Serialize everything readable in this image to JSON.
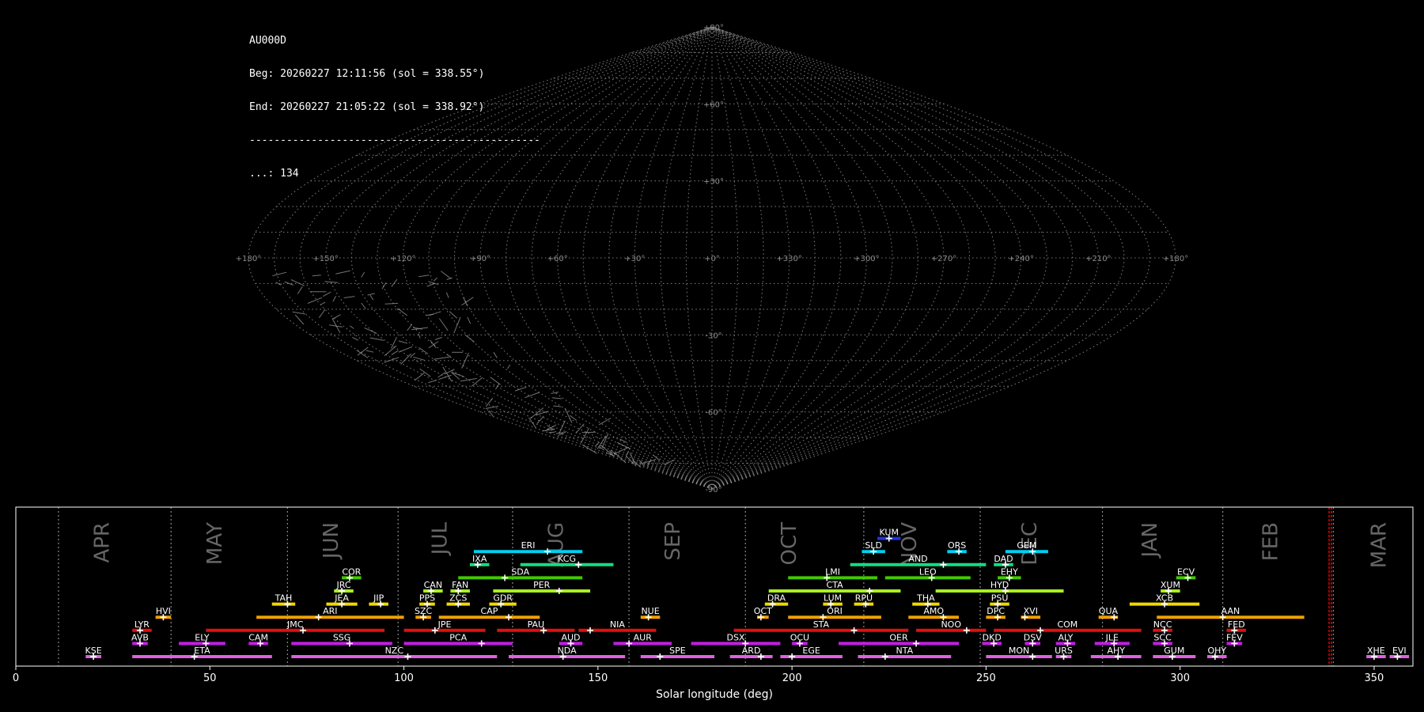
{
  "info": {
    "station": "AU000D",
    "beg": "Beg: 20260227 12:11:56 (sol = 338.55°)",
    "end": "End: 20260227 21:05:22 (sol = 338.92°)",
    "separator": "-----------------------------------------------",
    "count": "...: 134"
  },
  "colors": {
    "background": "#000000",
    "grid": "#8a8a8a",
    "frame": "#ffffff",
    "month_text": "#666666",
    "current_marker": "#e00000"
  },
  "chart_data": [
    {
      "type": "scatter",
      "projection": "sinusoidal",
      "xlabel": "",
      "ylabel": "",
      "lon_range": [
        -180,
        180
      ],
      "lat_range": [
        -90,
        90
      ],
      "lon_tick_labels": [
        "+180°",
        "+150°",
        "+120°",
        "+90°",
        "+60°",
        "+30°",
        "+0°",
        "+330°",
        "+300°",
        "+270°",
        "+240°",
        "+210°",
        "+180°"
      ],
      "lat_tick_labels": [
        "+90°",
        "+60°",
        "+30°",
        "+0°",
        "-30°",
        "-60°",
        "-90°"
      ],
      "grid": true,
      "n_points": 134
    },
    {
      "type": "bar",
      "orientation": "horizontal-range",
      "xlabel": "Solar longitude (deg)",
      "ylabel": "",
      "xlim": [
        0,
        360
      ],
      "xticks": [
        0,
        50,
        100,
        150,
        200,
        250,
        300,
        350
      ],
      "current_sol": 338.7,
      "month_boundaries": [
        11,
        40,
        70,
        98.5,
        128,
        158,
        188,
        218.5,
        248.5,
        280,
        311,
        339.5
      ],
      "months": [
        {
          "label": "APR",
          "x": 24
        },
        {
          "label": "MAY",
          "x": 53
        },
        {
          "label": "JUN",
          "x": 83
        },
        {
          "label": "JUL",
          "x": 111
        },
        {
          "label": "AUG",
          "x": 141
        },
        {
          "label": "SEP",
          "x": 171
        },
        {
          "label": "OCT",
          "x": 201
        },
        {
          "label": "NOV",
          "x": 232
        },
        {
          "label": "DEC",
          "x": 263
        },
        {
          "label": "JAN",
          "x": 294
        },
        {
          "label": "FEB",
          "x": 325
        },
        {
          "label": "MAR",
          "x": 353
        }
      ],
      "showers": [
        {
          "code": "KUM",
          "start": 222,
          "end": 228,
          "peak": 225,
          "row": 10,
          "color": "#2233dd"
        },
        {
          "code": "ERI",
          "start": 118,
          "end": 146,
          "peak": 137,
          "row": 9,
          "color": "#00d0f0"
        },
        {
          "code": "SLD",
          "start": 218,
          "end": 224,
          "peak": 221,
          "row": 9,
          "color": "#00d0f0"
        },
        {
          "code": "ORS",
          "start": 240,
          "end": 245,
          "peak": 243,
          "row": 9,
          "color": "#00d0f0"
        },
        {
          "code": "GEM",
          "start": 255,
          "end": 266,
          "peak": 262,
          "row": 9,
          "color": "#00d0f0"
        },
        {
          "code": "IXA",
          "start": 117,
          "end": 122,
          "peak": 119,
          "row": 8,
          "color": "#10e080"
        },
        {
          "code": "KCG",
          "start": 130,
          "end": 154,
          "peak": 145,
          "row": 8,
          "color": "#10e080"
        },
        {
          "code": "AND",
          "start": 215,
          "end": 250,
          "peak": 239,
          "row": 8,
          "color": "#10e080"
        },
        {
          "code": "DAD",
          "start": 252,
          "end": 257,
          "peak": 255,
          "row": 8,
          "color": "#10e080"
        },
        {
          "code": "COR",
          "start": 84,
          "end": 89,
          "peak": 86,
          "row": 7,
          "color": "#44c800"
        },
        {
          "code": "SDA",
          "start": 114,
          "end": 146,
          "peak": 126,
          "row": 7,
          "color": "#44c800"
        },
        {
          "code": "LMI",
          "start": 199,
          "end": 222,
          "peak": 209,
          "row": 7,
          "color": "#44c800"
        },
        {
          "code": "LEO",
          "start": 224,
          "end": 246,
          "peak": 236,
          "row": 7,
          "color": "#44c800"
        },
        {
          "code": "EHY",
          "start": 253,
          "end": 259,
          "peak": 256,
          "row": 7,
          "color": "#44c800"
        },
        {
          "code": "ECV",
          "start": 299,
          "end": 304,
          "peak": 302,
          "row": 7,
          "color": "#44c800"
        },
        {
          "code": "JRC",
          "start": 82,
          "end": 87,
          "peak": 84,
          "row": 6,
          "color": "#a8f020"
        },
        {
          "code": "CAN",
          "start": 105,
          "end": 110,
          "peak": 107,
          "row": 6,
          "color": "#a8f020"
        },
        {
          "code": "FAN",
          "start": 112,
          "end": 117,
          "peak": 114,
          "row": 6,
          "color": "#a8f020"
        },
        {
          "code": "PER",
          "start": 123,
          "end": 148,
          "peak": 140,
          "row": 6,
          "color": "#a8f020"
        },
        {
          "code": "CTA",
          "start": 194,
          "end": 228,
          "peak": 220,
          "row": 6,
          "color": "#a8f020"
        },
        {
          "code": "HYD",
          "start": 237,
          "end": 270,
          "peak": 255,
          "row": 6,
          "color": "#a8f020"
        },
        {
          "code": "XUM",
          "start": 295,
          "end": 300,
          "peak": 297,
          "row": 6,
          "color": "#a8f020"
        },
        {
          "code": "TAH",
          "start": 66,
          "end": 72,
          "peak": 70,
          "row": 5,
          "color": "#f0d800"
        },
        {
          "code": "JEA",
          "start": 80,
          "end": 88,
          "peak": 84,
          "row": 5,
          "color": "#f0d800"
        },
        {
          "code": "JIP",
          "start": 91,
          "end": 96,
          "peak": 94,
          "row": 5,
          "color": "#f0d800"
        },
        {
          "code": "PPS",
          "start": 104,
          "end": 108,
          "peak": 106,
          "row": 5,
          "color": "#f0d800"
        },
        {
          "code": "ZCS",
          "start": 111,
          "end": 117,
          "peak": 114,
          "row": 5,
          "color": "#f0d800"
        },
        {
          "code": "GDR",
          "start": 122,
          "end": 129,
          "peak": 125,
          "row": 5,
          "color": "#f0d800"
        },
        {
          "code": "DRA",
          "start": 193,
          "end": 199,
          "peak": 195,
          "row": 5,
          "color": "#f0d800"
        },
        {
          "code": "LUM",
          "start": 208,
          "end": 213,
          "peak": 210,
          "row": 5,
          "color": "#f0d800"
        },
        {
          "code": "RPU",
          "start": 216,
          "end": 221,
          "peak": 219,
          "row": 5,
          "color": "#f0d800"
        },
        {
          "code": "THA",
          "start": 231,
          "end": 238,
          "peak": 235,
          "row": 5,
          "color": "#f0d800"
        },
        {
          "code": "PSU",
          "start": 251,
          "end": 256,
          "peak": 253,
          "row": 5,
          "color": "#f0d800"
        },
        {
          "code": "XCB",
          "start": 287,
          "end": 305,
          "peak": 296,
          "row": 5,
          "color": "#f0d800"
        },
        {
          "code": "HVI",
          "start": 36,
          "end": 40,
          "peak": 38,
          "row": 4,
          "color": "#f0a000"
        },
        {
          "code": "ARI",
          "start": 62,
          "end": 100,
          "peak": 78,
          "row": 4,
          "color": "#f0a000"
        },
        {
          "code": "SZC",
          "start": 103,
          "end": 107,
          "peak": 105,
          "row": 4,
          "color": "#f0a000"
        },
        {
          "code": "CAP",
          "start": 109,
          "end": 135,
          "peak": 127,
          "row": 4,
          "color": "#f0a000"
        },
        {
          "code": "NUE",
          "start": 161,
          "end": 166,
          "peak": 163,
          "row": 4,
          "color": "#f0a000"
        },
        {
          "code": "OCT",
          "start": 191,
          "end": 194,
          "peak": 192,
          "row": 4,
          "color": "#f0a000"
        },
        {
          "code": "ORI",
          "start": 199,
          "end": 223,
          "peak": 208,
          "row": 4,
          "color": "#f0a000"
        },
        {
          "code": "AMO",
          "start": 230,
          "end": 243,
          "peak": 239,
          "row": 4,
          "color": "#f0a000"
        },
        {
          "code": "DPC",
          "start": 250,
          "end": 255,
          "peak": 253,
          "row": 4,
          "color": "#f0a000"
        },
        {
          "code": "XVI",
          "start": 259,
          "end": 264,
          "peak": 260,
          "row": 4,
          "color": "#f0a000"
        },
        {
          "code": "QUA",
          "start": 279,
          "end": 284,
          "peak": 283,
          "row": 4,
          "color": "#f0a000"
        },
        {
          "code": "AAN",
          "start": 294,
          "end": 332,
          "peak": 311,
          "row": 4,
          "color": "#f0a000"
        },
        {
          "code": "LYR",
          "start": 30,
          "end": 35,
          "peak": 32,
          "row": 3,
          "color": "#e01010"
        },
        {
          "code": "JMC",
          "start": 49,
          "end": 95,
          "peak": 74,
          "row": 3,
          "color": "#e01010"
        },
        {
          "code": "JPE",
          "start": 100,
          "end": 121,
          "peak": 108,
          "row": 3,
          "color": "#e01010"
        },
        {
          "code": "PAU",
          "start": 124,
          "end": 144,
          "peak": 136,
          "row": 3,
          "color": "#e01010"
        },
        {
          "code": "NIA",
          "start": 145,
          "end": 165,
          "peak": 148,
          "row": 3,
          "color": "#e01010"
        },
        {
          "code": "STA",
          "start": 185,
          "end": 230,
          "peak": 216,
          "row": 3,
          "color": "#e01010"
        },
        {
          "code": "NOO",
          "start": 232,
          "end": 250,
          "peak": 245,
          "row": 3,
          "color": "#e01010"
        },
        {
          "code": "COM",
          "start": 252,
          "end": 290,
          "peak": 264,
          "row": 3,
          "color": "#e01010"
        },
        {
          "code": "NCC",
          "start": 293,
          "end": 298,
          "peak": 296,
          "row": 3,
          "color": "#e01010"
        },
        {
          "code": "FED",
          "start": 312,
          "end": 317,
          "peak": 314,
          "row": 3,
          "color": "#e01010"
        },
        {
          "code": "AVB",
          "start": 30,
          "end": 34,
          "peak": 32,
          "row": 2,
          "color": "#c020e0"
        },
        {
          "code": "ELY",
          "start": 42,
          "end": 54,
          "peak": 49,
          "row": 2,
          "color": "#c020e0"
        },
        {
          "code": "CAM",
          "start": 60,
          "end": 65,
          "peak": 63,
          "row": 2,
          "color": "#c020e0"
        },
        {
          "code": "SSG",
          "start": 71,
          "end": 97,
          "peak": 86,
          "row": 2,
          "color": "#c020e0"
        },
        {
          "code": "PCA",
          "start": 100,
          "end": 128,
          "peak": 120,
          "row": 2,
          "color": "#c020e0"
        },
        {
          "code": "AUD",
          "start": 140,
          "end": 146,
          "peak": 143,
          "row": 2,
          "color": "#c020e0"
        },
        {
          "code": "AUR",
          "start": 154,
          "end": 169,
          "peak": 158,
          "row": 2,
          "color": "#c020e0"
        },
        {
          "code": "DSX",
          "start": 174,
          "end": 197,
          "peak": 188,
          "row": 2,
          "color": "#c020e0"
        },
        {
          "code": "OCU",
          "start": 200,
          "end": 204,
          "peak": 202,
          "row": 2,
          "color": "#c020e0"
        },
        {
          "code": "OER",
          "start": 212,
          "end": 243,
          "peak": 232,
          "row": 2,
          "color": "#c020e0"
        },
        {
          "code": "DKD",
          "start": 249,
          "end": 254,
          "peak": 252,
          "row": 2,
          "color": "#c020e0"
        },
        {
          "code": "DSV",
          "start": 260,
          "end": 264,
          "peak": 262,
          "row": 2,
          "color": "#c020e0"
        },
        {
          "code": "ALY",
          "start": 268,
          "end": 273,
          "peak": 271,
          "row": 2,
          "color": "#c020e0"
        },
        {
          "code": "JLE",
          "start": 278,
          "end": 287,
          "peak": 283,
          "row": 2,
          "color": "#c020e0"
        },
        {
          "code": "SCC",
          "start": 293,
          "end": 298,
          "peak": 296,
          "row": 2,
          "color": "#c020e0"
        },
        {
          "code": "FEV",
          "start": 312,
          "end": 316,
          "peak": 314,
          "row": 2,
          "color": "#c020e0"
        },
        {
          "code": "KSE",
          "start": 18,
          "end": 22,
          "peak": 20,
          "row": 1,
          "color": "#e060e0"
        },
        {
          "code": "ETA",
          "start": 30,
          "end": 66,
          "peak": 46,
          "row": 1,
          "color": "#e060e0"
        },
        {
          "code": "NZC",
          "start": 71,
          "end": 124,
          "peak": 101,
          "row": 1,
          "color": "#e060e0"
        },
        {
          "code": "NDA",
          "start": 127,
          "end": 157,
          "peak": 141,
          "row": 1,
          "color": "#e060e0"
        },
        {
          "code": "SPE",
          "start": 161,
          "end": 180,
          "peak": 166,
          "row": 1,
          "color": "#e060e0"
        },
        {
          "code": "ARD",
          "start": 184,
          "end": 195,
          "peak": 192,
          "row": 1,
          "color": "#e060e0"
        },
        {
          "code": "EGE",
          "start": 197,
          "end": 213,
          "peak": 200,
          "row": 1,
          "color": "#e060e0"
        },
        {
          "code": "NTA",
          "start": 217,
          "end": 241,
          "peak": 224,
          "row": 1,
          "color": "#e060e0"
        },
        {
          "code": "MON",
          "start": 250,
          "end": 267,
          "peak": 262,
          "row": 1,
          "color": "#e060e0"
        },
        {
          "code": "URS",
          "start": 268,
          "end": 272,
          "peak": 270,
          "row": 1,
          "color": "#e060e0"
        },
        {
          "code": "AHY",
          "start": 277,
          "end": 290,
          "peak": 284,
          "row": 1,
          "color": "#e060e0"
        },
        {
          "code": "GUM",
          "start": 293,
          "end": 304,
          "peak": 298,
          "row": 1,
          "color": "#e060e0"
        },
        {
          "code": "OHY",
          "start": 307,
          "end": 312,
          "peak": 309,
          "row": 1,
          "color": "#e060e0"
        },
        {
          "code": "XHE",
          "start": 348,
          "end": 353,
          "peak": 350,
          "row": 1,
          "color": "#e060e0"
        },
        {
          "code": "EVI",
          "start": 354,
          "end": 359,
          "peak": 356,
          "row": 1,
          "color": "#e060e0"
        }
      ]
    }
  ]
}
